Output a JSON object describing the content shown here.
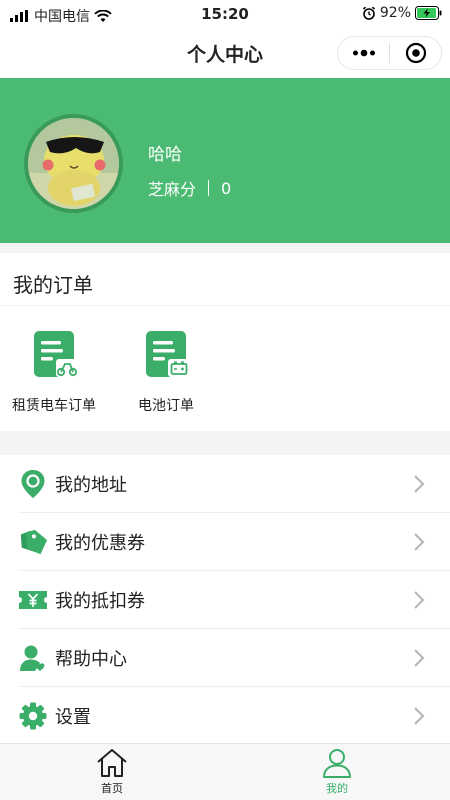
{
  "status_bar": {
    "carrier": "中国电信",
    "time": "15:20",
    "battery": "92%"
  },
  "nav": {
    "title": "个人中心"
  },
  "profile": {
    "username": "哈哈",
    "score_label": "芝麻分",
    "score_value": "0"
  },
  "orders": {
    "title": "我的订单",
    "items": [
      {
        "label": "租赁电车订单",
        "icon": "ebike-order-icon"
      },
      {
        "label": "电池订单",
        "icon": "battery-order-icon"
      }
    ]
  },
  "menu": {
    "items": [
      {
        "label": "我的地址",
        "icon": "location-pin-icon"
      },
      {
        "label": "我的优惠券",
        "icon": "coupon-tag-icon"
      },
      {
        "label": "我的抵扣券",
        "icon": "voucher-ticket-icon"
      },
      {
        "label": "帮助中心",
        "icon": "help-person-icon"
      },
      {
        "label": "设置",
        "icon": "gear-icon"
      }
    ]
  },
  "tabbar": {
    "items": [
      {
        "label": "首页",
        "icon": "home-icon",
        "active": false
      },
      {
        "label": "我的",
        "icon": "user-icon",
        "active": true
      }
    ]
  },
  "colors": {
    "accent": "#4bbb74",
    "icon_green": "#3aae69"
  }
}
